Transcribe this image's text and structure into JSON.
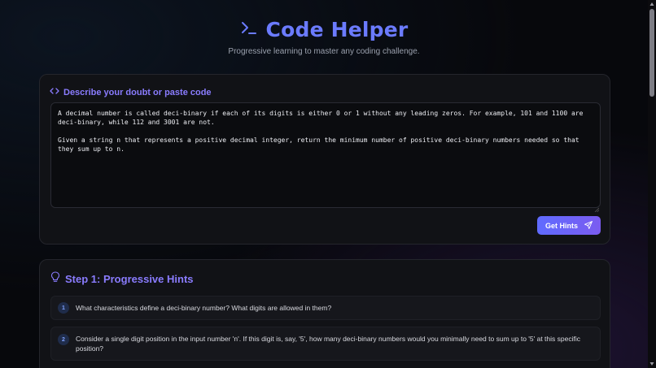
{
  "header": {
    "title": "Code Helper",
    "subtitle": "Progressive learning to master any coding challenge.",
    "icon": "terminal-icon"
  },
  "input_card": {
    "title": "Describe your doubt or paste code",
    "icon": "code-icon",
    "textarea_value": "A decimal number is called deci-binary if each of its digits is either 0 or 1 without any leading zeros. For example, 101 and 1100 are deci-binary, while 112 and 3001 are not.\n\nGiven a string n that represents a positive decimal integer, return the minimum number of positive deci-binary numbers needed so that they sum up to n.",
    "button_label": "Get Hints",
    "button_icon": "send-icon"
  },
  "hints_card": {
    "title": "Step 1: Progressive Hints",
    "icon": "lightbulb-icon",
    "hints": [
      {
        "num": "1",
        "text": "What characteristics define a deci-binary number? What digits are allowed in them?"
      },
      {
        "num": "2",
        "text": "Consider a single digit position in the input number 'n'. If this digit is, say, '5', how many deci-binary numbers would you minimally need to sum up to '5' at this specific position?"
      }
    ]
  },
  "colors": {
    "accent": "#6b7bff",
    "accent_purple": "#8a7cff",
    "background": "#07080c",
    "card": "#111216"
  }
}
